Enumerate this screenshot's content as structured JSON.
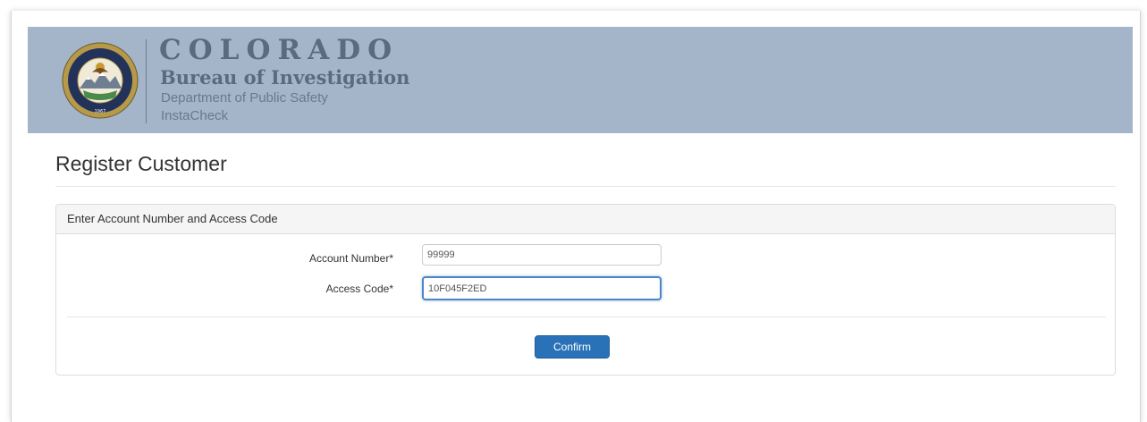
{
  "header": {
    "title": "COLORADO",
    "bureau": "Bureau of Investigation",
    "department": "Department of Public Safety",
    "app_name": "InstaCheck",
    "background_color": "#a4b4c9",
    "seal_icon": "colorado-cbi-seal-icon"
  },
  "page": {
    "title": "Register Customer"
  },
  "form": {
    "panel_heading": "Enter Account Number and Access Code",
    "account_number_label": "Account Number*",
    "account_number_value": "99999",
    "access_code_label": "Access Code*",
    "access_code_value": "10F045F2ED",
    "confirm_label": "Confirm",
    "accent_color": "#2a72b8"
  }
}
